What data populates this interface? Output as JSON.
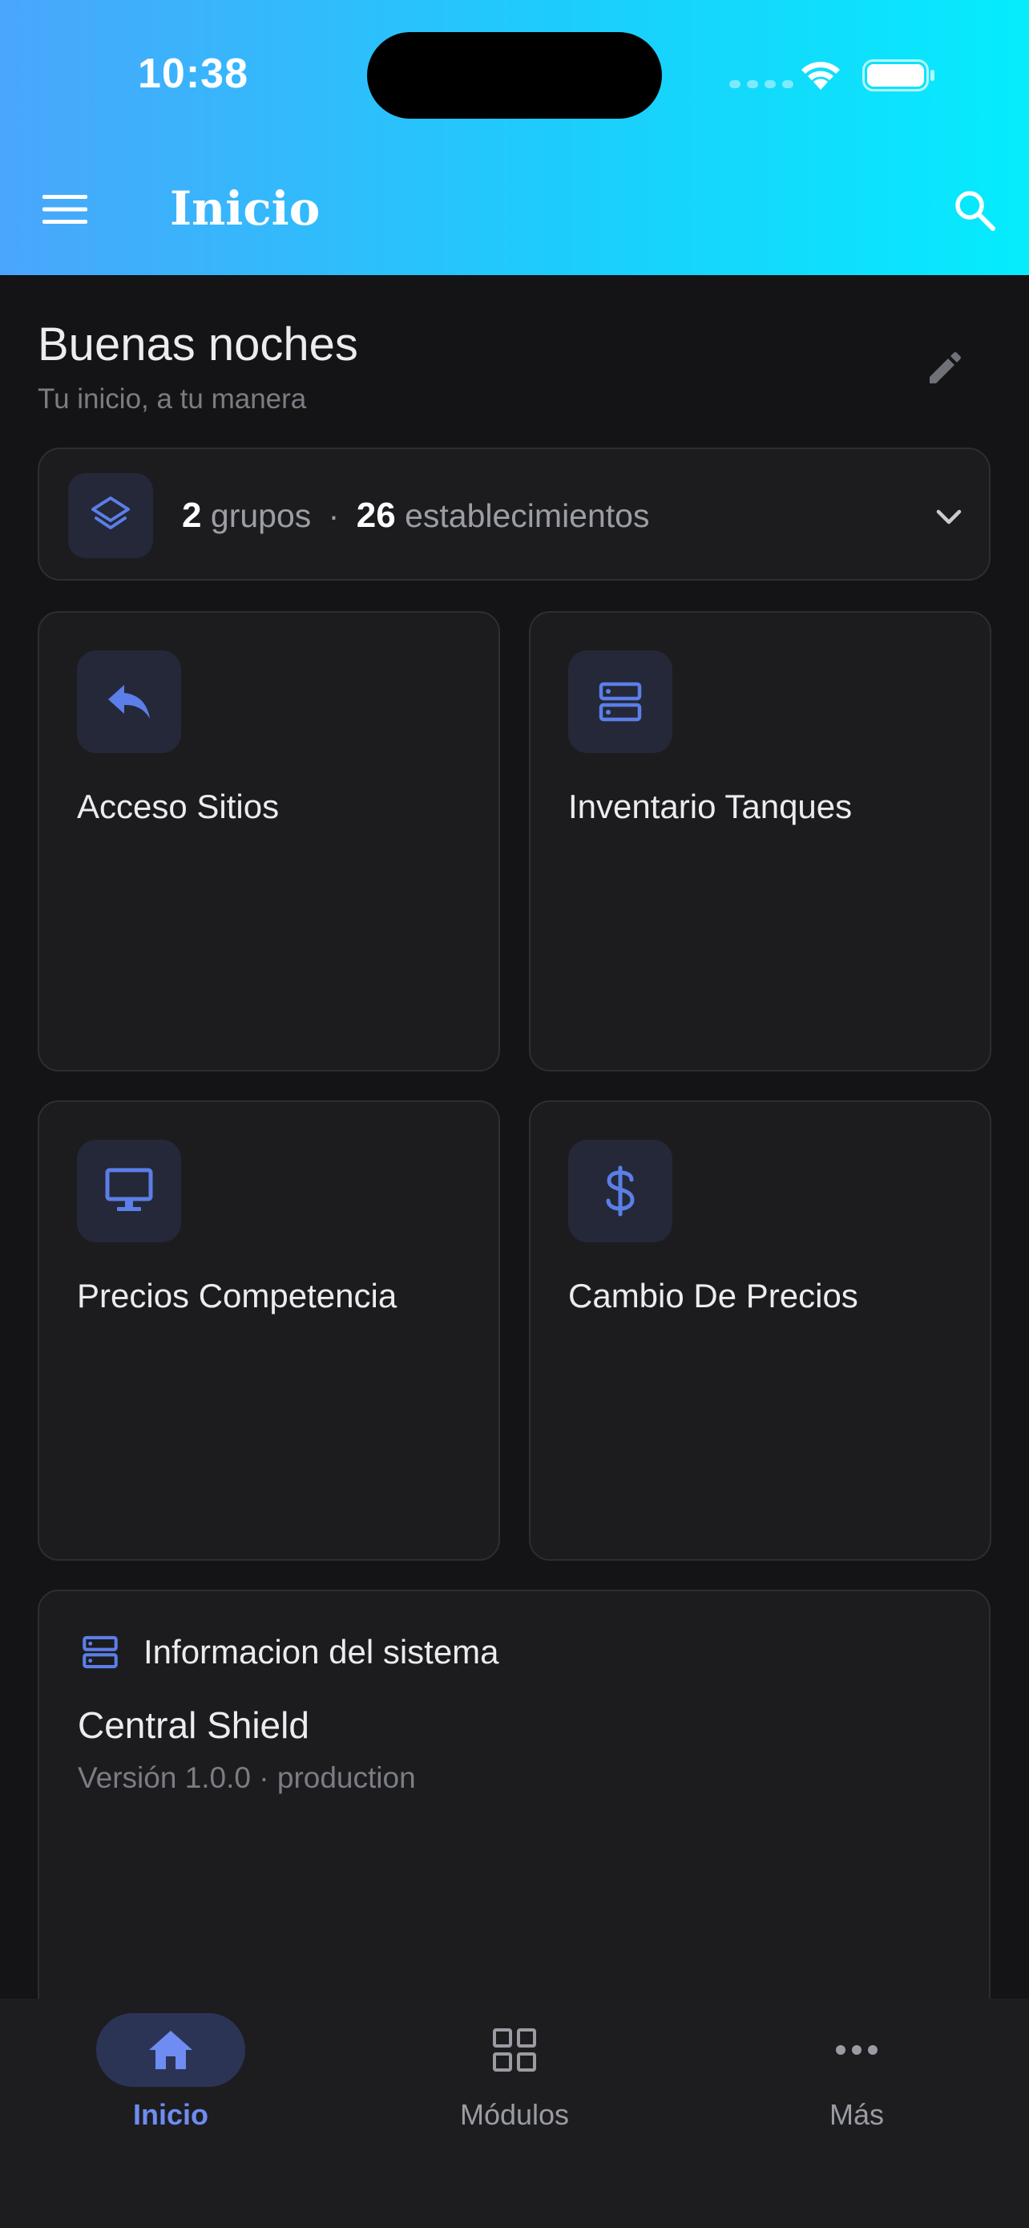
{
  "status_bar": {
    "time": "10:38"
  },
  "app_bar": {
    "title": "Inicio",
    "menu_icon": "menu-icon",
    "search_icon": "search-icon",
    "gradient": [
      "#4aa6fb",
      "#05ecfd"
    ]
  },
  "greeting": {
    "title": "Buenas noches",
    "subtitle": "Tu inicio, a tu manera"
  },
  "summary": {
    "groups_count": "2",
    "groups_label": "grupos",
    "separator": "·",
    "sites_count": "26",
    "sites_label": "establecimientos"
  },
  "tiles": [
    {
      "label": "Acceso Sitios",
      "icon": "reply-arrow-icon"
    },
    {
      "label": "Inventario Tanques",
      "icon": "server-icon"
    },
    {
      "label": "Precios Competencia",
      "icon": "monitor-icon"
    },
    {
      "label": "Cambio De Precios",
      "icon": "dollar-icon"
    }
  ],
  "system_info": {
    "title": "Informacion del sistema",
    "product": "Central Shield",
    "version": "Versión 1.0.0 · production"
  },
  "bottom_nav": [
    {
      "label": "Inicio",
      "icon": "home-icon",
      "active": true
    },
    {
      "label": "Módulos",
      "icon": "grid-icon",
      "active": false
    },
    {
      "label": "Más",
      "icon": "more-horizontal-icon",
      "active": false
    }
  ],
  "colors": {
    "accent": "#4f74e3",
    "background": "#141416",
    "card": "#1c1c1f",
    "nav_active": "#6f8cf2"
  }
}
